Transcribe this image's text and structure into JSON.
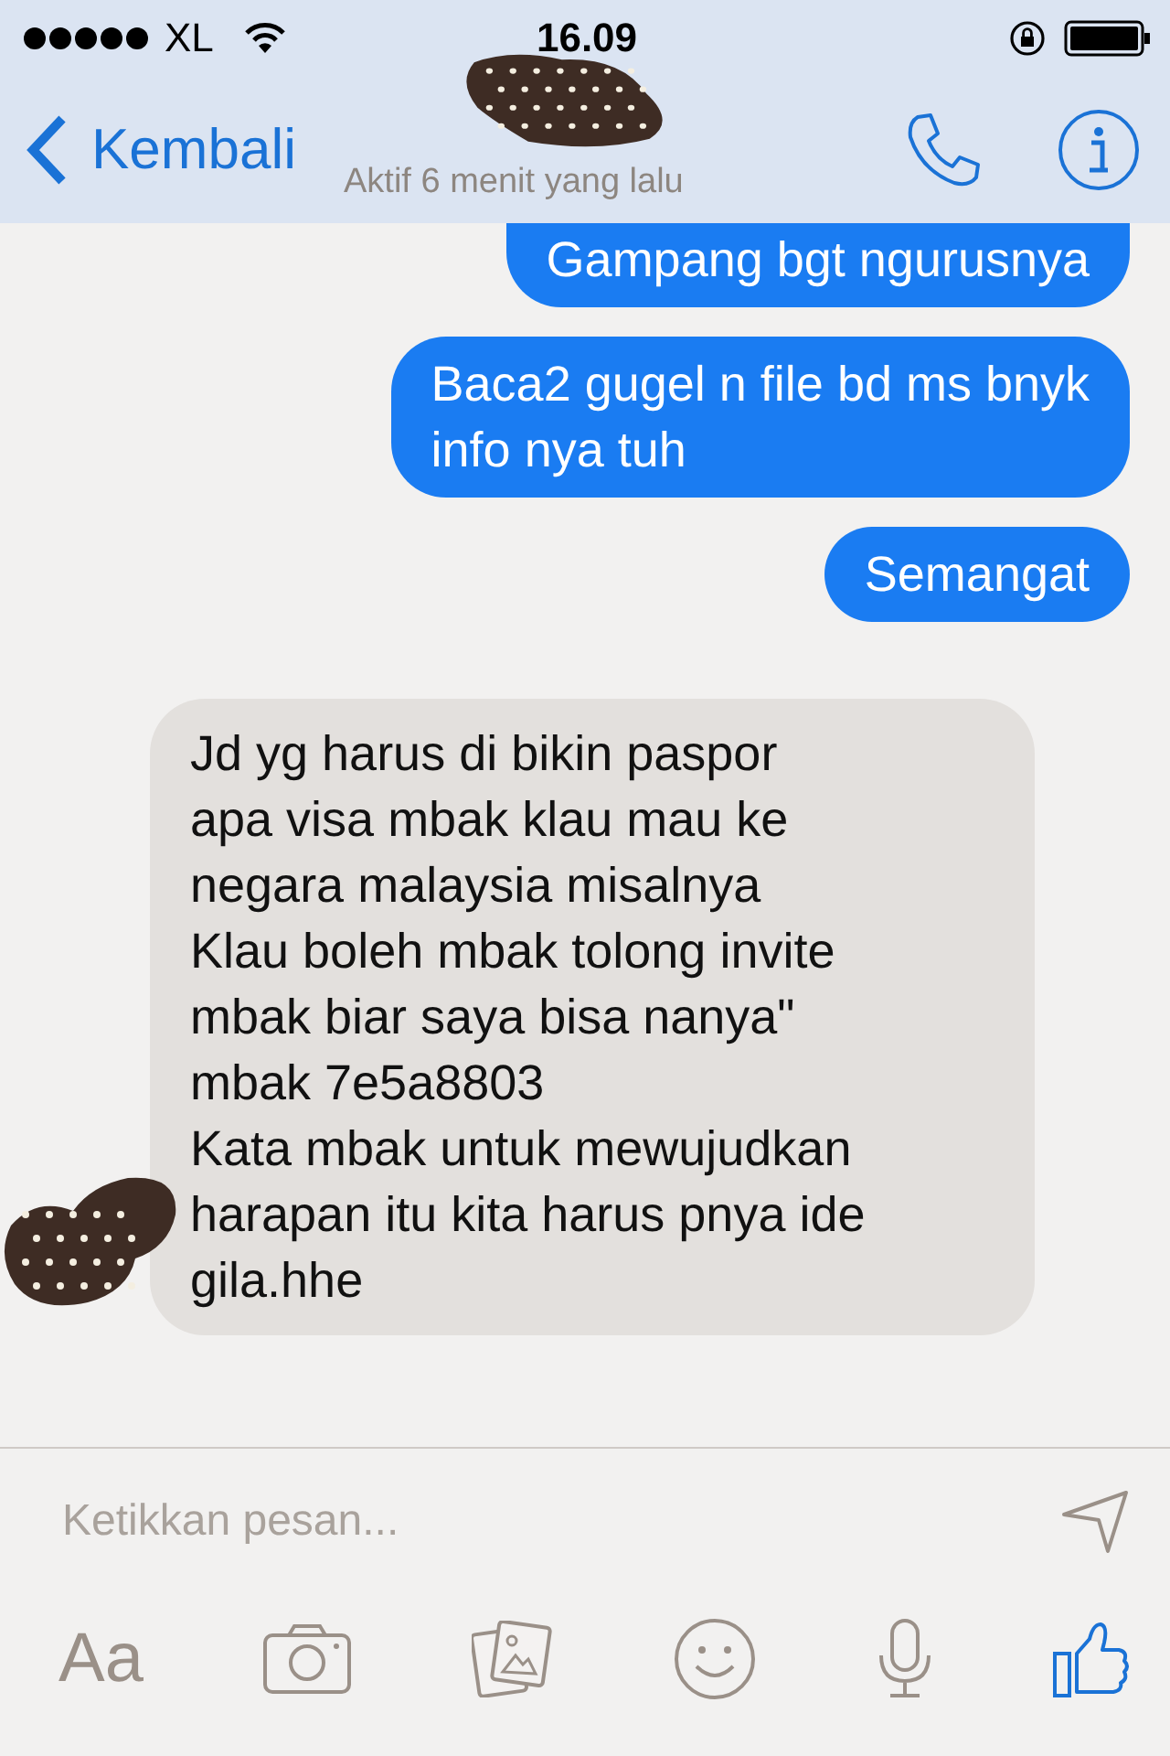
{
  "status_bar": {
    "carrier": "XL",
    "time": "16.09"
  },
  "nav": {
    "back": "Kembali",
    "subtitle": "Aktif 6 menit yang lalu"
  },
  "messages": [
    {
      "kind": "outgoing",
      "text": "Gampang bgt ngurusnya"
    },
    {
      "kind": "outgoing",
      "text": "Baca2 gugel n file bd ms bnyk\ninfo nya tuh"
    },
    {
      "kind": "outgoing",
      "text": "Semangat"
    },
    {
      "kind": "incoming",
      "text": "Jd yg harus di bikin paspor\napa visa mbak klau mau ke\nnegara malaysia misalnya\nKlau boleh mbak tolong invite\nmbak biar saya bisa nanya\"\nmbak 7e5a8803\nKata mbak untuk mewujudkan\nharapan itu kita harus pnya ide\ngila.hhe"
    }
  ],
  "composer": {
    "placeholder": "Ketikkan pesan..."
  },
  "toolbar": {
    "text_button": "Aa"
  }
}
